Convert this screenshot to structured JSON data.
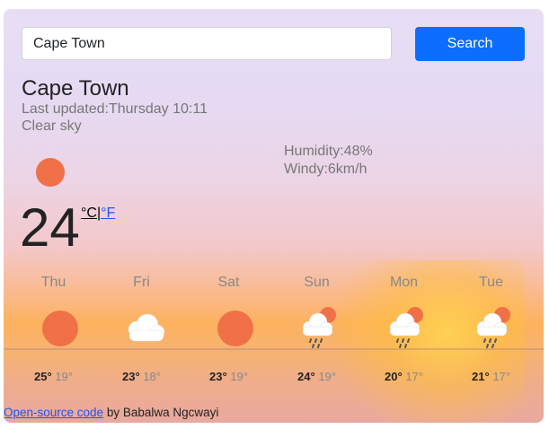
{
  "search": {
    "value": "Cape Town",
    "button_label": "Search"
  },
  "current": {
    "city": "Cape Town",
    "last_updated": "Last updated:Thursday 10:11",
    "description": "Clear sky",
    "humidity": "Humidity:48%",
    "wind": "Windy:6km/h",
    "temperature": "24",
    "icon": "clear-sky-icon",
    "unit_celsius": "°C",
    "unit_separator": "|",
    "unit_fahrenheit": "°F"
  },
  "forecast": [
    {
      "day": "Thu",
      "icon": "clear-sky-icon",
      "max": "25°",
      "min": "19°"
    },
    {
      "day": "Fri",
      "icon": "cloud-icon",
      "max": "23°",
      "min": "18°"
    },
    {
      "day": "Sat",
      "icon": "clear-sky-icon",
      "max": "23°",
      "min": "19°"
    },
    {
      "day": "Sun",
      "icon": "rain-icon",
      "max": "24°",
      "min": "19°"
    },
    {
      "day": "Mon",
      "icon": "rain-icon",
      "max": "20°",
      "min": "17°"
    },
    {
      "day": "Tue",
      "icon": "rain-icon",
      "max": "21°",
      "min": "17°"
    }
  ],
  "footer": {
    "link_text": "Open-source code",
    "author_text": "by Babalwa Ngcwayi"
  },
  "colors": {
    "accent": "#0d6efd",
    "sun": "#f07148",
    "link": "#1a55ff"
  }
}
